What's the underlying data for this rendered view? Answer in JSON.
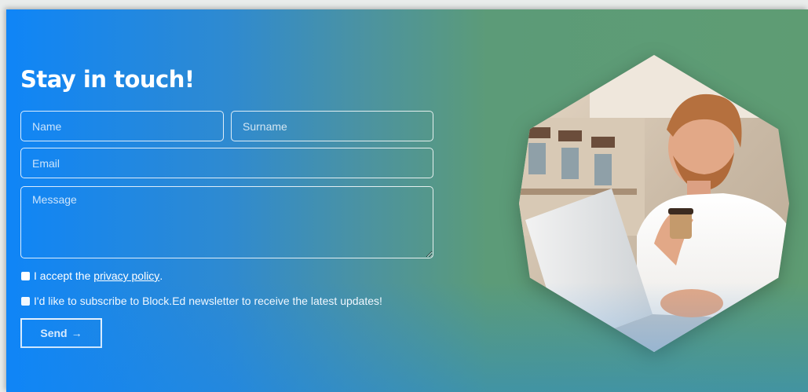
{
  "heading": "Stay in touch!",
  "form": {
    "name_placeholder": "Name",
    "surname_placeholder": "Surname",
    "email_placeholder": "Email",
    "message_placeholder": "Message",
    "privacy_prefix": "I accept the ",
    "privacy_link": "privacy policy",
    "privacy_suffix": ".",
    "newsletter_label": "I'd like to subscribe to Block.Ed newsletter to receive the latest updates!",
    "send_label": "Send",
    "send_arrow": "→"
  },
  "colors": {
    "gradient_start": "#0f85f7",
    "gradient_end": "#5e9c73",
    "text": "#ffffff"
  },
  "image": {
    "icon": "photo-man-laptop-coffee"
  }
}
